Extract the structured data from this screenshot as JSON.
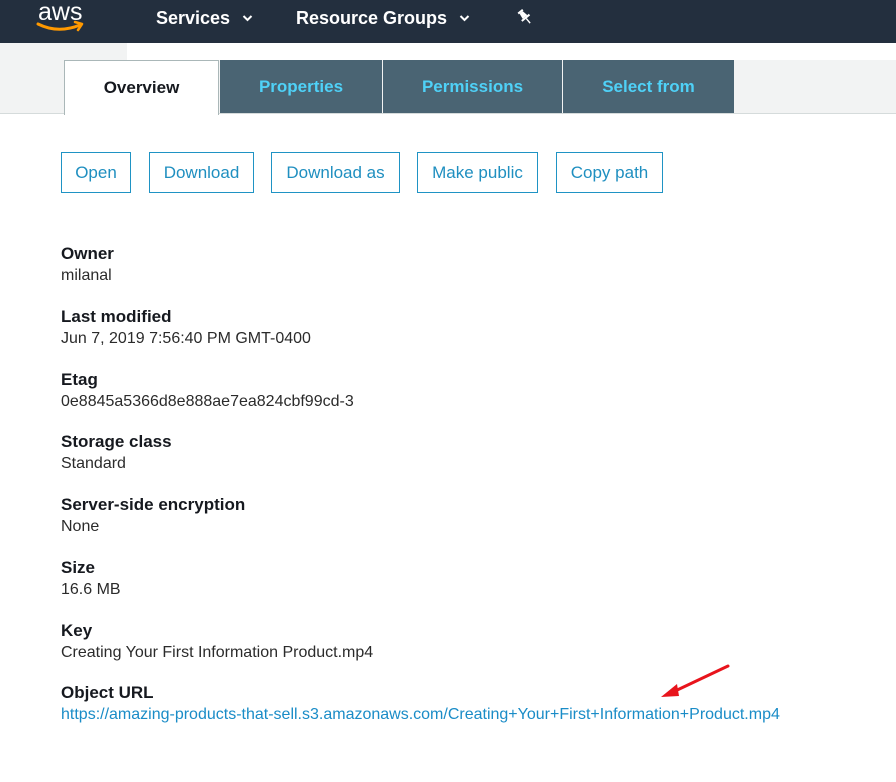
{
  "header": {
    "logo_text": "aws",
    "services_label": "Services",
    "resource_groups_label": "Resource Groups",
    "pin_icon": "pin-icon",
    "background_color": "#232f3e"
  },
  "tabs": [
    {
      "label": "Overview",
      "active": true
    },
    {
      "label": "Properties",
      "active": false
    },
    {
      "label": "Permissions",
      "active": false
    },
    {
      "label": "Select from",
      "active": false
    }
  ],
  "actions": {
    "open": "Open",
    "download": "Download",
    "download_as": "Download as",
    "make_public": "Make public",
    "copy_path": "Copy path"
  },
  "properties": {
    "owner": {
      "label": "Owner",
      "value": "milanal"
    },
    "last_modified": {
      "label": "Last modified",
      "value": "Jun 7, 2019 7:56:40 PM GMT-0400"
    },
    "etag": {
      "label": "Etag",
      "value": "0e8845a5366d8e888ae7ea824cbf99cd-3"
    },
    "storage_class": {
      "label": "Storage class",
      "value": "Standard"
    },
    "encryption": {
      "label": "Server-side encryption",
      "value": "None"
    },
    "size": {
      "label": "Size",
      "value": "16.6 MB"
    },
    "key": {
      "label": "Key",
      "value": "Creating Your First Information Product.mp4"
    },
    "object_url": {
      "label": "Object URL",
      "value": "https://amazing-products-that-sell.s3.amazonaws.com/Creating+Your+First+Information+Product.mp4"
    }
  },
  "colors": {
    "accent": "#1f8fc0",
    "tab_inactive_bg": "#4a6473",
    "tab_inactive_text": "#4fd1f7",
    "annotation_arrow": "#e8141c"
  }
}
